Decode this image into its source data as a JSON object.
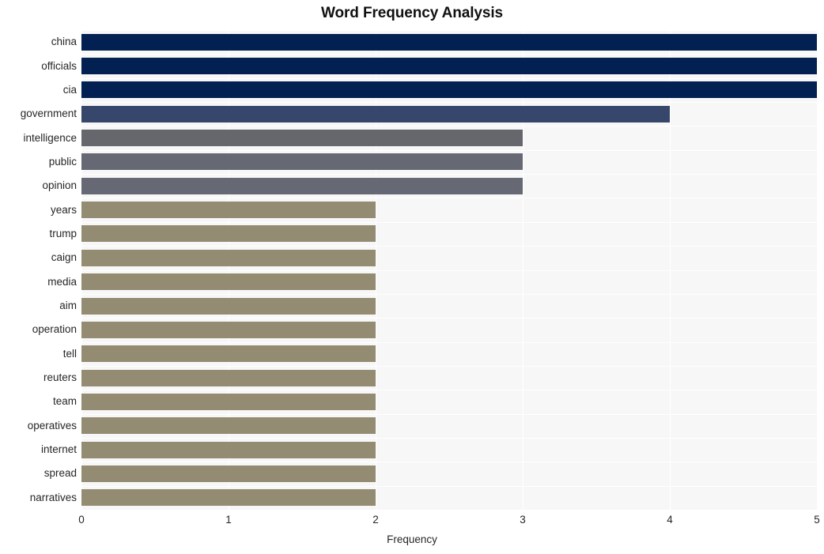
{
  "chart_data": {
    "type": "bar",
    "orientation": "horizontal",
    "title": "Word Frequency Analysis",
    "xlabel": "Frequency",
    "ylabel": "",
    "xlim": [
      0,
      5
    ],
    "xticks": [
      "0",
      "1",
      "2",
      "3",
      "4",
      "5"
    ],
    "grid": true,
    "legend": null,
    "categories": [
      "china",
      "officials",
      "cia",
      "government",
      "intelligence",
      "public",
      "opinion",
      "years",
      "trump",
      "caign",
      "media",
      "aim",
      "operation",
      "tell",
      "reuters",
      "team",
      "operatives",
      "internet",
      "spread",
      "narratives"
    ],
    "values": [
      5,
      5,
      5,
      4,
      3,
      3,
      3,
      2,
      2,
      2,
      2,
      2,
      2,
      2,
      2,
      2,
      2,
      2,
      2,
      2
    ],
    "bar_colors": [
      "#022052",
      "#022052",
      "#022052",
      "#37466b",
      "#65676d",
      "#666973",
      "#666973",
      "#938c73",
      "#938c73",
      "#938c73",
      "#938c73",
      "#938c73",
      "#938c73",
      "#938c73",
      "#938c73",
      "#938c73",
      "#938c73",
      "#938c73",
      "#938c73",
      "#938c73"
    ],
    "plot_background": "#f7f7f7",
    "grid_color": "#ffffff",
    "figure_background": "#ffffff",
    "text_color": "#262626"
  }
}
